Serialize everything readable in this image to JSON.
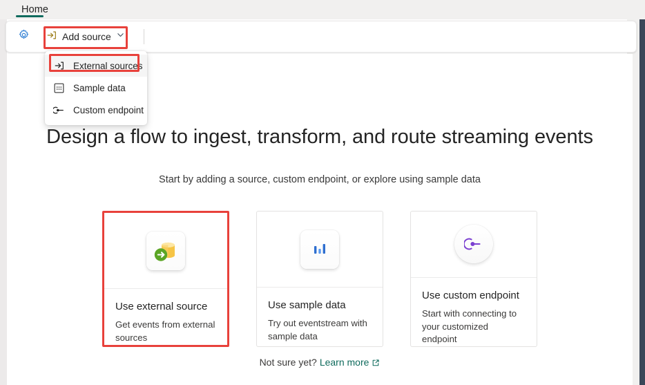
{
  "window": {
    "accent_teal": "#0f6b5d",
    "highlight_red": "#e8413b"
  },
  "ribbon": {
    "tabs": [
      {
        "label": "Home",
        "active": true
      }
    ]
  },
  "toolbar": {
    "settings_icon": "gear-icon",
    "add_source": {
      "label": "Add source",
      "icon": "arrow-into-bracket-icon",
      "chevron": "chevron-down-icon",
      "highlighted": true
    }
  },
  "menu": {
    "items": [
      {
        "label": "External sources",
        "icon": "arrow-into-bracket-icon",
        "selected": true
      },
      {
        "label": "Sample data",
        "icon": "dotted-square-icon",
        "selected": false
      },
      {
        "label": "Custom endpoint",
        "icon": "custom-endpoint-icon",
        "selected": false
      }
    ]
  },
  "main": {
    "headline": "Design a flow to ingest, transform, and route streaming events",
    "subhead": "Start by adding a source, custom endpoint, or explore using sample data",
    "cards": [
      {
        "title": "Use external source",
        "description": "Get events from external sources",
        "icon": "external-database-source-icon",
        "selected": true
      },
      {
        "title": "Use sample data",
        "description": "Try out eventstream with sample data",
        "icon": "bar-chart-icon",
        "selected": false
      },
      {
        "title": "Use custom endpoint",
        "description": "Start with connecting to your customized endpoint",
        "icon": "custom-endpoint-icon",
        "selected": false
      }
    ],
    "footer": {
      "prompt": "Not sure yet?",
      "link_label": "Learn more",
      "link_icon": "external-link-icon"
    }
  }
}
